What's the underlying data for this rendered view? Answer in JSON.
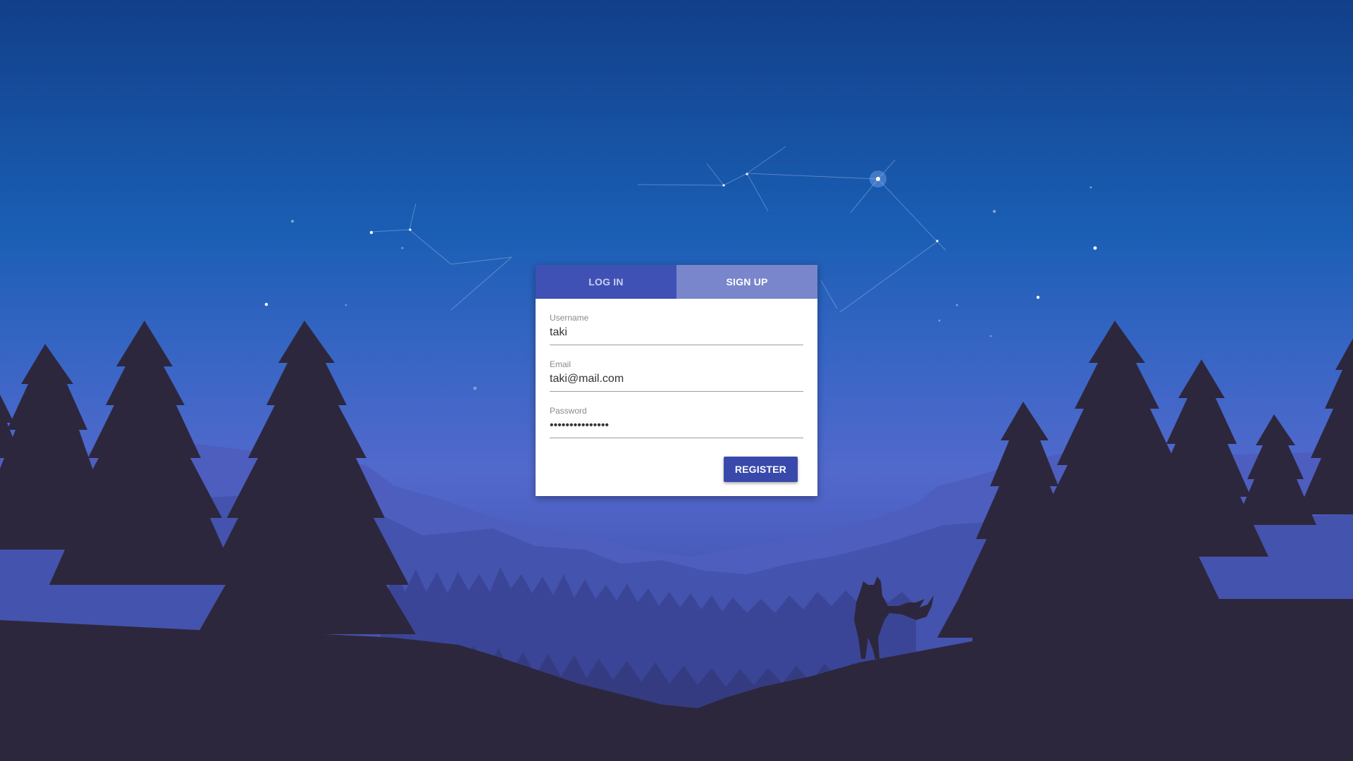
{
  "auth": {
    "tabs": [
      {
        "label": "LOG IN",
        "active": false
      },
      {
        "label": "SIGN UP",
        "active": true
      }
    ],
    "fields": {
      "username": {
        "label": "Username",
        "value": "taki"
      },
      "email": {
        "label": "Email",
        "value": "taki@mail.com"
      },
      "password": {
        "label": "Password",
        "value": "•••••••••••••••"
      }
    },
    "submit_label": "REGISTER"
  },
  "theme": {
    "primary": "#3f51b5",
    "tab_inactive": "#7986cb",
    "button": "#3949ab",
    "sky_top": "#123f89",
    "silhouette": "#2d273d"
  },
  "background": {
    "scene": "night sky with constellation over forest and mountains",
    "figure": "fox-silhouette"
  }
}
